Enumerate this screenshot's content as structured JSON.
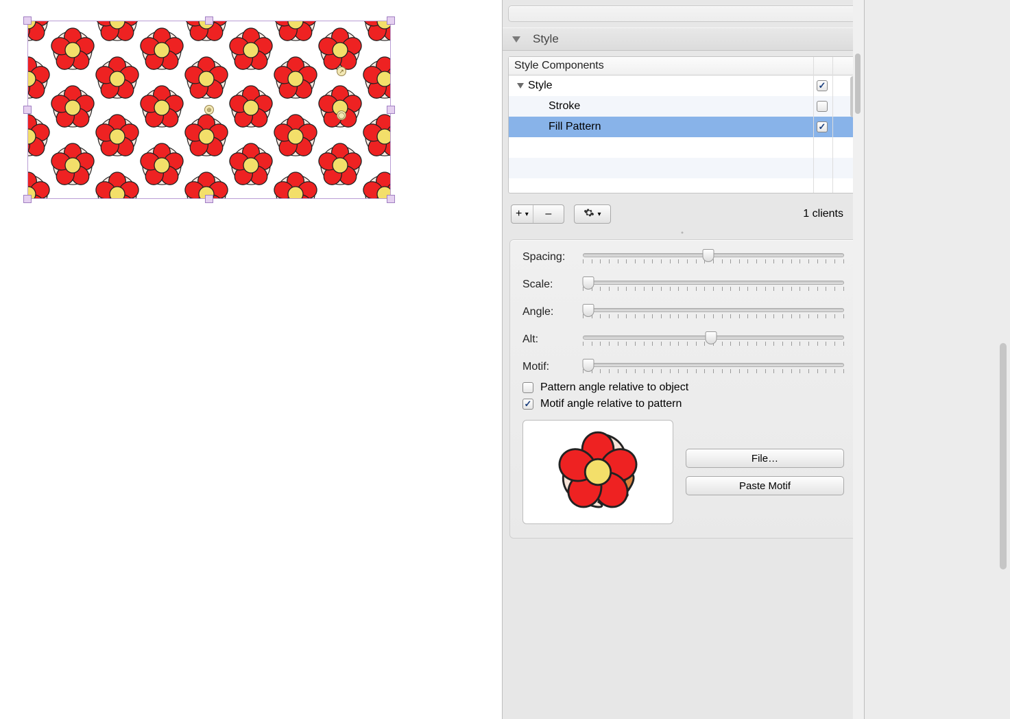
{
  "style_section": {
    "header_label": "Style",
    "list_header": "Style Components",
    "rows": {
      "style": {
        "label": "Style",
        "checked": true
      },
      "stroke": {
        "label": "Stroke",
        "checked": false
      },
      "fill_pattern": {
        "label": "Fill Pattern",
        "checked": true
      }
    }
  },
  "toolbar": {
    "add_glyph": "+",
    "add_menu_glyph": "▾",
    "remove_glyph": "–",
    "gear_glyph": "✱",
    "gear_menu_glyph": "▾",
    "clients_text": "1  clients"
  },
  "sliders": {
    "spacing": {
      "label": "Spacing:",
      "value_pct": 48
    },
    "scale": {
      "label": "Scale:",
      "value_pct": 2
    },
    "angle": {
      "label": "Angle:",
      "value_pct": 2
    },
    "alt": {
      "label": "Alt:",
      "value_pct": 49
    },
    "motif": {
      "label": "Motif:",
      "value_pct": 2
    }
  },
  "options": {
    "pattern_rel": {
      "label": "Pattern angle relative to object",
      "checked": false
    },
    "motif_rel": {
      "label": "Motif angle relative to pattern",
      "checked": true
    }
  },
  "motif_buttons": {
    "file": "File…",
    "paste": "Paste Motif"
  }
}
